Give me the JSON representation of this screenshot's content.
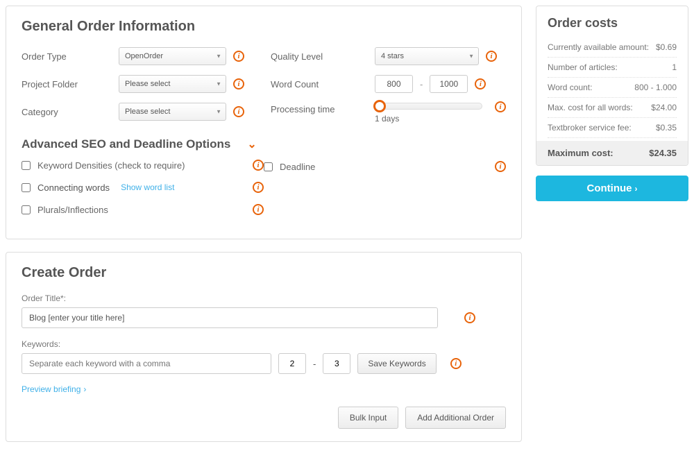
{
  "general": {
    "title": "General Order Information",
    "order_type_label": "Order Type",
    "order_type_value": "OpenOrder",
    "project_folder_label": "Project Folder",
    "project_folder_value": "Please select",
    "category_label": "Category",
    "category_value": "Please select",
    "quality_label": "Quality Level",
    "quality_value": "4 stars",
    "word_count_label": "Word Count",
    "word_min": "800",
    "word_max": "1000",
    "word_sep": "-",
    "processing_label": "Processing time",
    "processing_value": "1 days"
  },
  "advanced": {
    "title": "Advanced SEO and Deadline Options",
    "keyword_densities": "Keyword Densities (check to require)",
    "connecting_words": "Connecting words",
    "show_word_list": "Show word list",
    "plurals": "Plurals/Inflections",
    "deadline": "Deadline"
  },
  "costs": {
    "title": "Order costs",
    "rows": [
      {
        "label": "Currently available amount:",
        "value": "$0.69"
      },
      {
        "label": "Number of articles:",
        "value": "1"
      },
      {
        "label": "Word count:",
        "value": "800 - 1.000"
      },
      {
        "label": "Max. cost for all words:",
        "value": "$24.00"
      },
      {
        "label": "Textbroker service fee:",
        "value": "$0.35"
      }
    ],
    "max_label": "Maximum cost:",
    "max_value": "$24.35",
    "continue": "Continue"
  },
  "create": {
    "title": "Create Order",
    "order_title_label": "Order Title*:",
    "order_title_value": "Blog [enter your title here]",
    "keywords_label": "Keywords:",
    "keywords_placeholder": "Separate each keyword with a comma",
    "kw_min": "2",
    "kw_max": "3",
    "kw_sep": "-",
    "save_keywords": "Save Keywords",
    "preview": "Preview briefing",
    "bulk_input": "Bulk Input",
    "add_additional": "Add Additional Order"
  }
}
